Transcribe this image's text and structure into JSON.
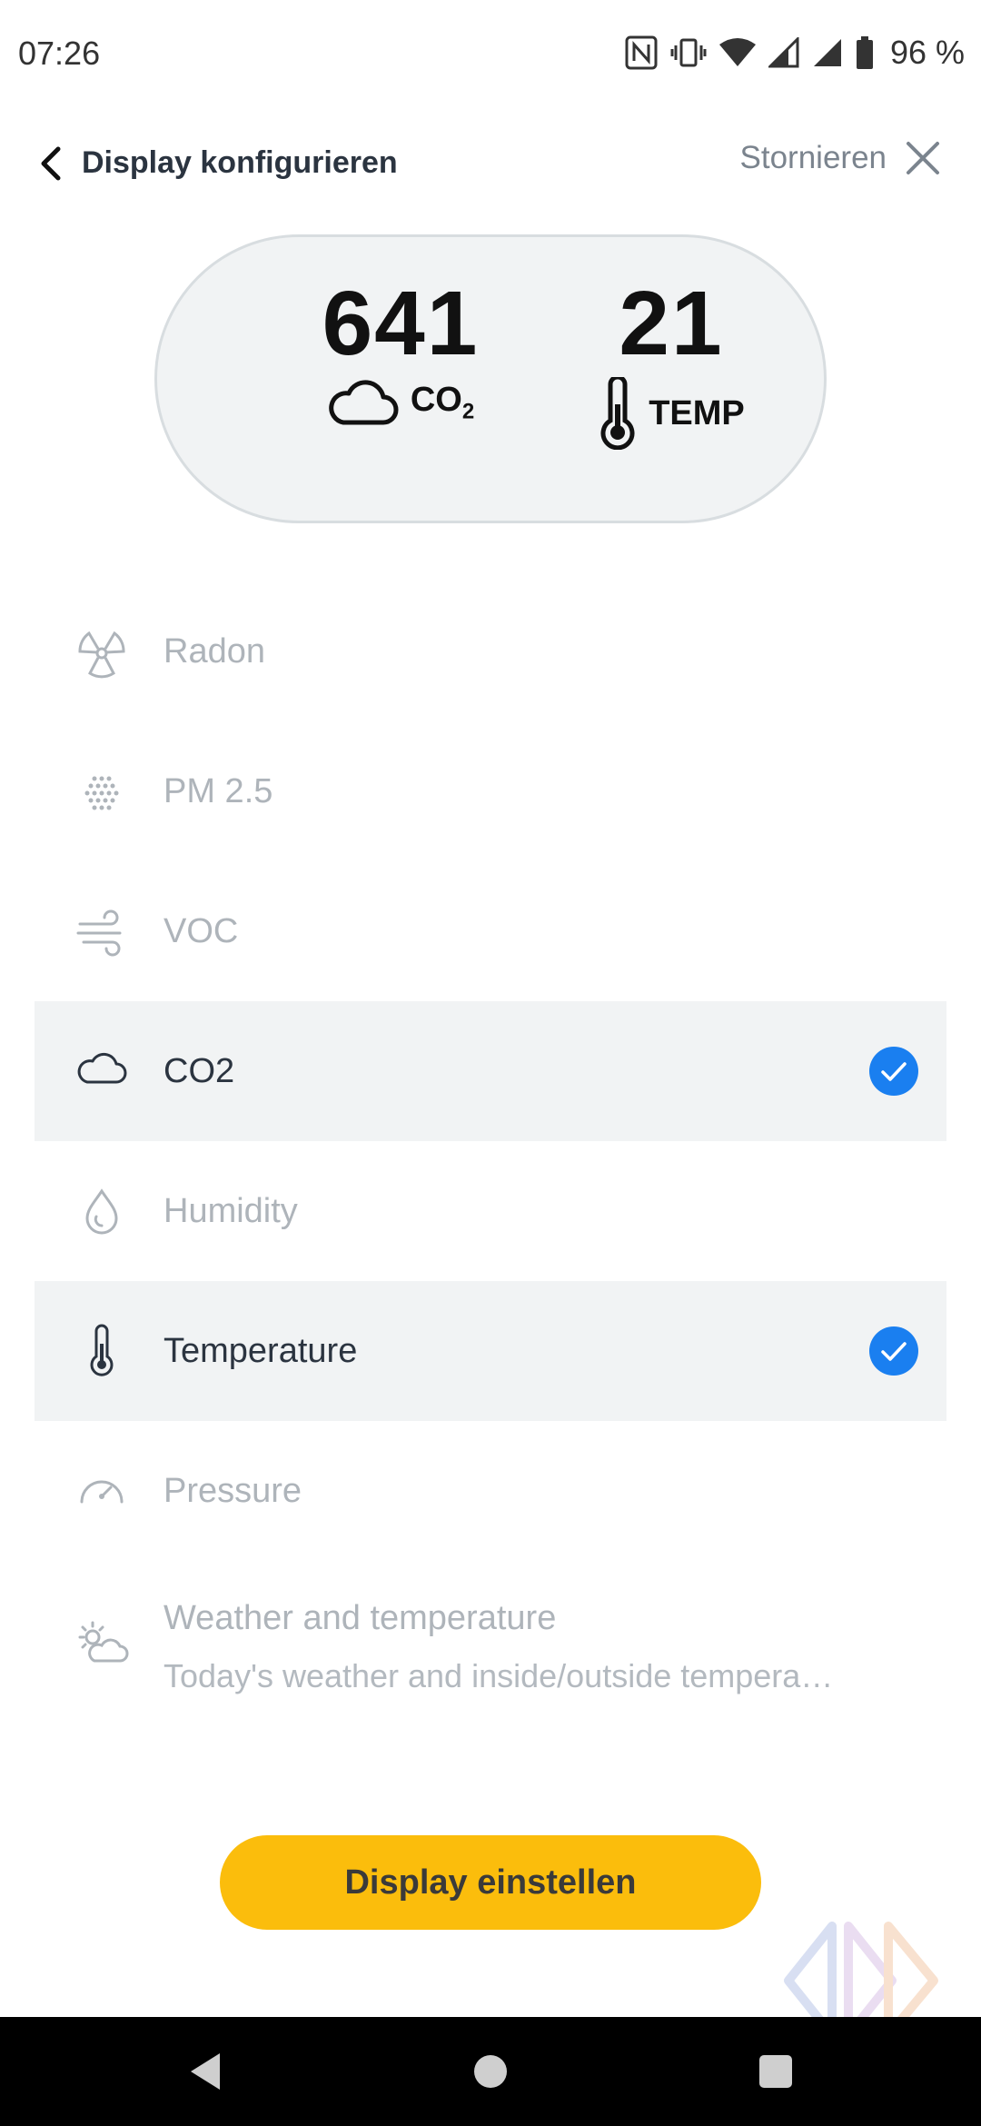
{
  "status_bar": {
    "time": "07:26",
    "battery_text": "96 %",
    "icons": [
      "nfc-icon",
      "vibrate-icon",
      "wifi-icon",
      "signal-icon",
      "signal-icon",
      "battery-icon"
    ]
  },
  "header": {
    "title": "Display konfigurieren",
    "cancel_label": "Stornieren",
    "back_icon": "chevron-left-icon",
    "close_icon": "close-icon"
  },
  "preview": {
    "metric1": {
      "value": "641",
      "label": "CO",
      "label_sub": "2",
      "icon": "cloud-icon"
    },
    "metric2": {
      "value": "21",
      "label": "TEMP",
      "icon": "thermometer-icon"
    }
  },
  "options": [
    {
      "label": "Radon",
      "icon": "radiation-icon",
      "selected": false
    },
    {
      "label": "PM 2.5",
      "icon": "particles-icon",
      "selected": false
    },
    {
      "label": "VOC",
      "icon": "wind-icon",
      "selected": false
    },
    {
      "label": "CO2",
      "icon": "cloud-icon",
      "selected": true
    },
    {
      "label": "Humidity",
      "icon": "drop-icon",
      "selected": false
    },
    {
      "label": "Temperature",
      "icon": "thermometer-icon",
      "selected": true
    },
    {
      "label": "Pressure",
      "icon": "gauge-icon",
      "selected": false
    },
    {
      "label": "Weather and temperature",
      "sublabel": "Today's weather and inside/outside tempera…",
      "icon": "weather-icon",
      "selected": false
    }
  ],
  "primary_button": {
    "label": "Display einstellen"
  },
  "colors": {
    "accent": "#fbbd0c",
    "check": "#1a7ff0",
    "selected_row": "#f1f3f4",
    "muted_text": "#aeb4ba"
  }
}
